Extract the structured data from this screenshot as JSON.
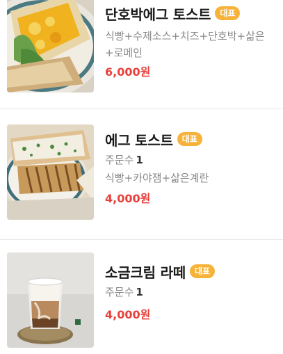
{
  "menu": {
    "items": [
      {
        "name": "단호박에그 토스트",
        "badge": "대표",
        "description_line1": "식빵+수제소스+치즈+단호박+삶은",
        "description_line2": "+로메인",
        "price": "6,000원",
        "image_icon": "pumpkin-egg-toast-photo"
      },
      {
        "name": "에그 토스트",
        "badge": "대표",
        "orders_label": "주문수",
        "orders_count": "1",
        "description": "식빵+카야잼+삶은계란",
        "price": "4,000원",
        "image_icon": "egg-toast-photo"
      },
      {
        "name": "소금크림 라떼",
        "badge": "대표",
        "orders_label": "주문수",
        "orders_count": "1",
        "price": "4,000원",
        "image_icon": "salt-cream-latte-photo"
      }
    ]
  },
  "colors": {
    "badge": "#f7b23a",
    "price": "#e8403c",
    "muted_text": "#888888"
  }
}
